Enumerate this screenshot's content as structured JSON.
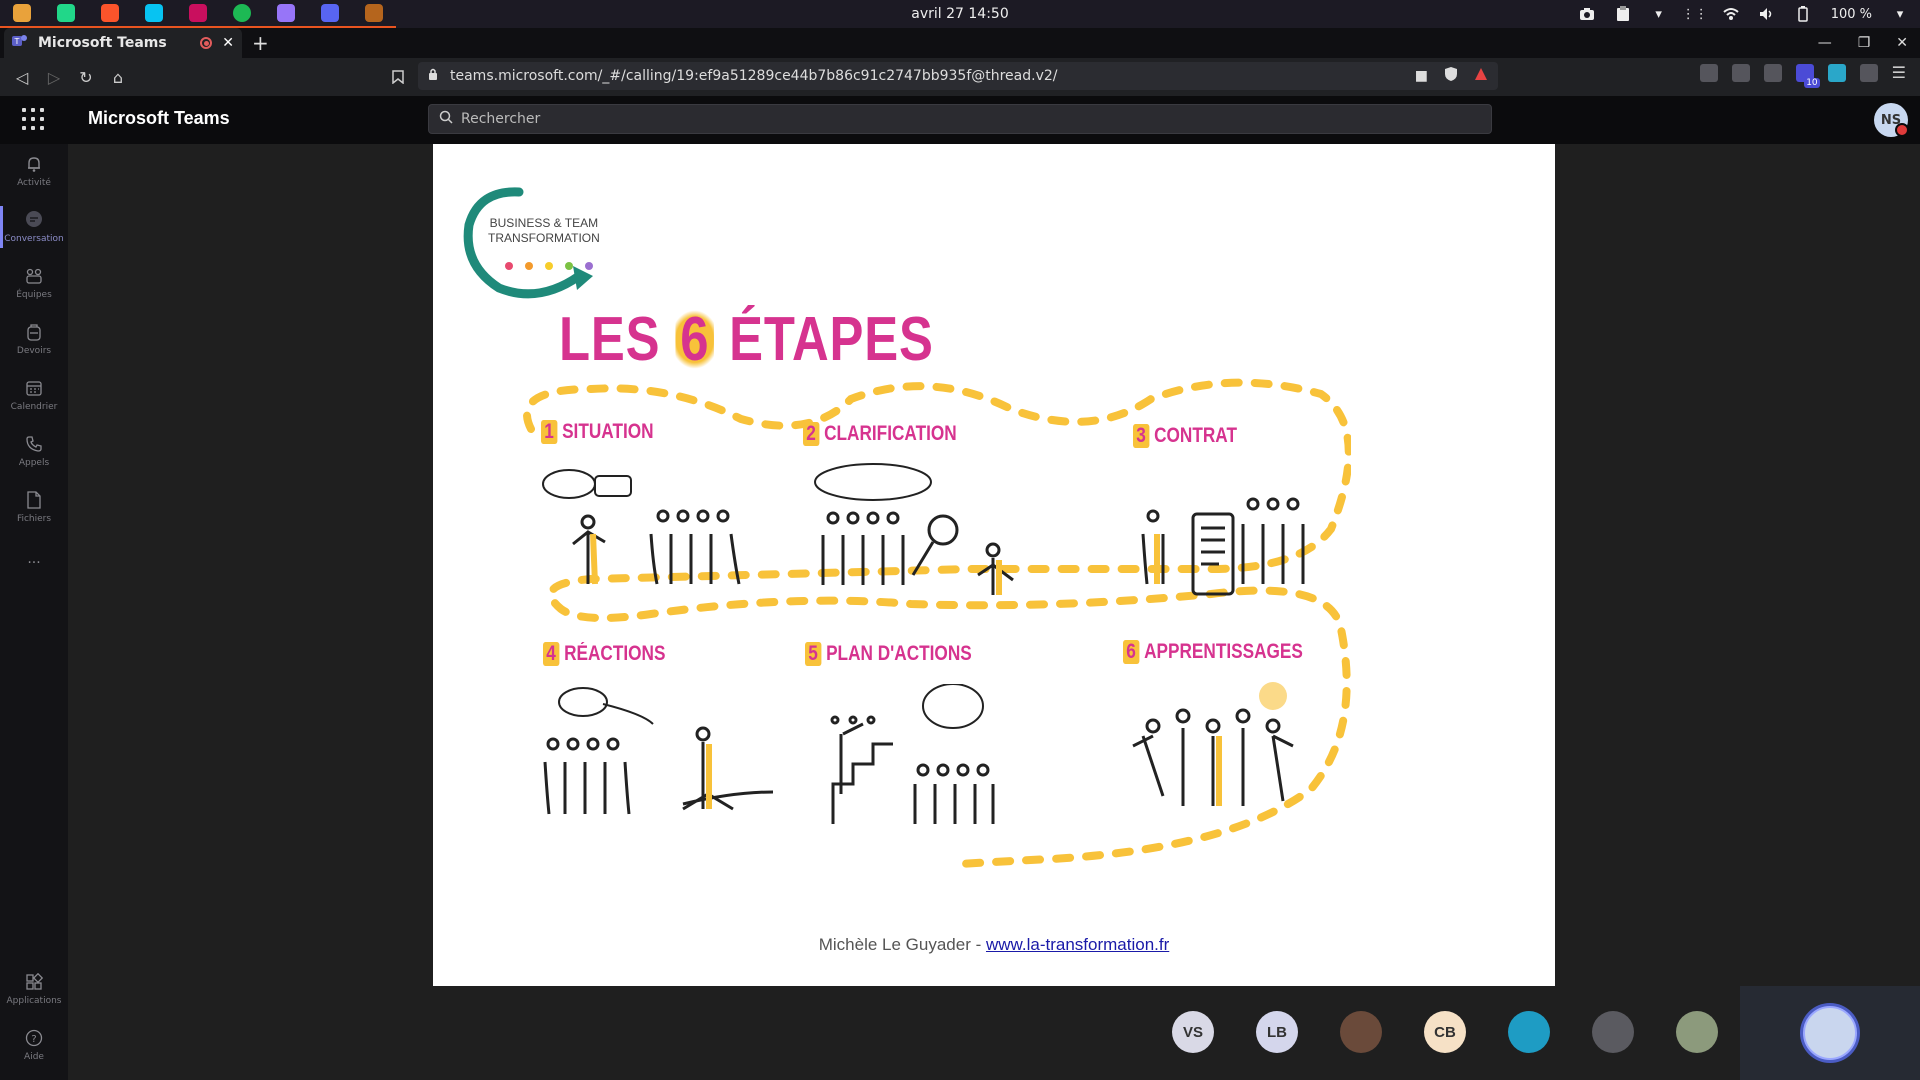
{
  "os": {
    "clock": "avril 27  14:50",
    "battery": "100 %",
    "apps": [
      {
        "name": "files-icon",
        "color": "#e9a23b"
      },
      {
        "name": "clion-icon",
        "color": "#21d789"
      },
      {
        "name": "brave-icon",
        "color": "#fb542b"
      },
      {
        "name": "webstorm-icon",
        "color": "#07c3f2"
      },
      {
        "name": "rider-icon",
        "color": "#c90f5e"
      },
      {
        "name": "spotify-icon",
        "color": "#1db954"
      },
      {
        "name": "datagrip-icon",
        "color": "#9775f8"
      },
      {
        "name": "discord-icon",
        "color": "#5865f2"
      },
      {
        "name": "archive-icon",
        "color": "#b5651d"
      }
    ]
  },
  "browser": {
    "tab_title": "Microsoft Teams",
    "url": "teams.microsoft.com/_#/calling/19:ef9a51289ce44b7b86c91c2747bb935f@thread.v2/",
    "extension_badge": "10"
  },
  "teams": {
    "title": "Microsoft Teams",
    "search_placeholder": "Rechercher",
    "profile_initials": "NS",
    "rail": [
      {
        "label": "Activité",
        "icon": "bell-icon"
      },
      {
        "label": "Conversation",
        "icon": "chat-icon"
      },
      {
        "label": "Équipes",
        "icon": "teams-icon"
      },
      {
        "label": "Devoirs",
        "icon": "backpack-icon"
      },
      {
        "label": "Calendrier",
        "icon": "calendar-icon"
      },
      {
        "label": "Appels",
        "icon": "phone-icon"
      },
      {
        "label": "Fichiers",
        "icon": "file-icon"
      },
      {
        "label": "···",
        "icon": "more-icon"
      }
    ],
    "rail_bottom": [
      {
        "label": "Applications",
        "icon": "apps-icon"
      },
      {
        "label": "Aide",
        "icon": "help-icon"
      }
    ]
  },
  "slide": {
    "logo_text_line1": "BUSINESS & TEAM",
    "logo_text_line2": "TRANSFORMATION",
    "title_prefix": "LES ",
    "title_number": "6",
    "title_suffix": " ÉTAPES",
    "steps": [
      {
        "num": "1",
        "label": "SITUATION"
      },
      {
        "num": "2",
        "label": "CLARIFICATION"
      },
      {
        "num": "3",
        "label": "CONTRAT"
      },
      {
        "num": "4",
        "label": "RÉACTIONS"
      },
      {
        "num": "5",
        "label": "PLAN D'ACTIONS"
      },
      {
        "num": "6",
        "label": "APPRENTISSAGES"
      }
    ],
    "credit_author": "Michèle Le Guyader - ",
    "credit_link": "www.la-transformation.fr",
    "colors": {
      "accent": "#d6338f",
      "path": "#f8c23a",
      "logo": "#1f8a7a"
    }
  },
  "participants": [
    {
      "initials": "VS",
      "bg": "#d9d9e6"
    },
    {
      "initials": "LB",
      "bg": "#d4d6ec"
    },
    {
      "initials": "",
      "bg": "#6a4a3a"
    },
    {
      "initials": "CB",
      "bg": "#f6e1c6"
    },
    {
      "initials": "",
      "bg": "#1e9cc4"
    },
    {
      "initials": "",
      "bg": "#5a5a60"
    },
    {
      "initials": "",
      "bg": "#8c9a7c"
    }
  ]
}
